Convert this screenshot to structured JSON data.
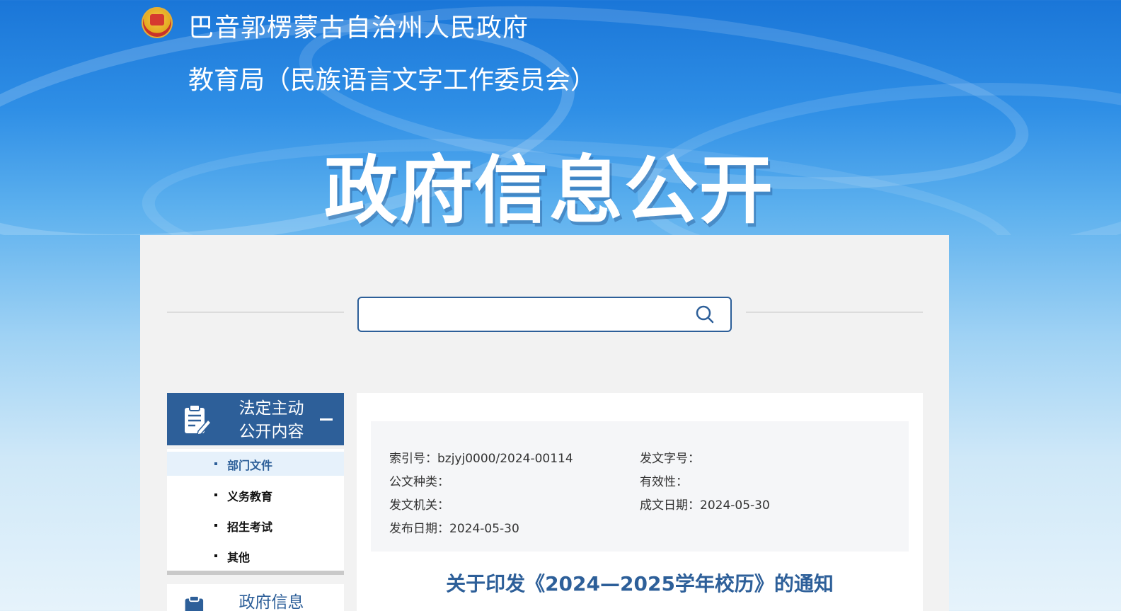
{
  "header": {
    "org_name": "巴音郭楞蒙古自治州人民政府",
    "dept_name": "教育局（民族语言文字工作委员会）",
    "banner_title": "政府信息公开"
  },
  "search": {
    "value": "",
    "placeholder": ""
  },
  "sidebar": {
    "section1_title_line1": "法定主动",
    "section1_title_line2": "公开内容",
    "items": [
      {
        "label": "部门文件",
        "active": true
      },
      {
        "label": "义务教育",
        "active": false
      },
      {
        "label": "招生考试",
        "active": false
      },
      {
        "label": "其他",
        "active": false
      }
    ],
    "section2_title": "政府信息"
  },
  "document": {
    "meta": {
      "index_no": "索引号：bzjyj0000/2024-00114",
      "doc_no": "发文字号：",
      "doc_type": "公文种类：",
      "validity": "有效性：",
      "issuer": "发文机关：",
      "written_date": "成文日期：2024-05-30",
      "publish_date": "发布日期：2024-05-30"
    },
    "title": "关于印发《2024—2025学年校历》的通知"
  },
  "colors": {
    "accent": "#2d5f99",
    "panel_bg": "#f2f2f2",
    "active_item_bg": "#e6f1fb"
  }
}
